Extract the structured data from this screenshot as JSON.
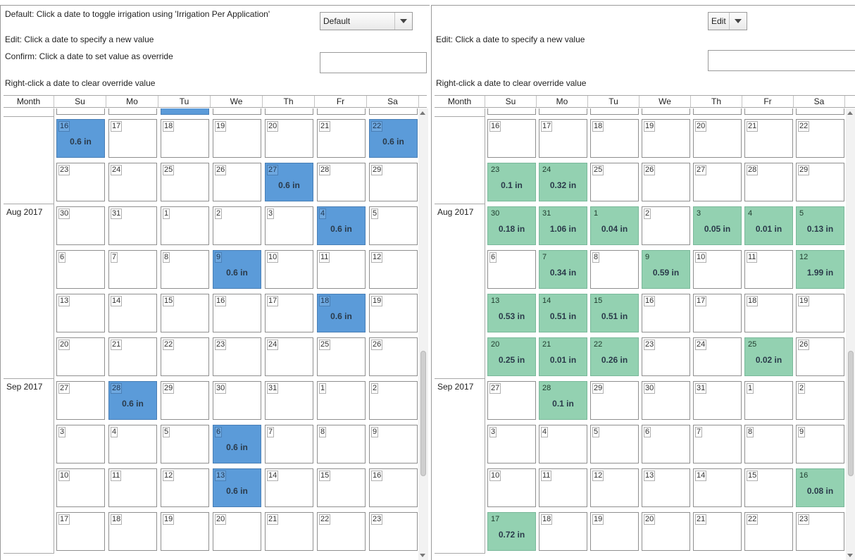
{
  "left": {
    "instructions": {
      "default": "Default: Click a date to toggle irrigation using 'Irrigation Per Application'",
      "edit": "Edit: Click a date to specify a new value",
      "confirm": "Confirm: Click a date to set value as override",
      "right_click": "Right-click a date to clear override value"
    },
    "mode_dropdown": {
      "value": "Default"
    },
    "override_input": {
      "value": ""
    },
    "headers": [
      "Month",
      "Su",
      "Mo",
      "Tu",
      "We",
      "Th",
      "Fr",
      "Sa"
    ],
    "months": [
      {
        "label": "",
        "rows": 2
      },
      {
        "label": "Aug 2017",
        "rows": 4
      },
      {
        "label": "Sep 2017",
        "rows": 4
      }
    ],
    "weeks": [
      [
        {
          "d": "16",
          "v": "0.6 in"
        },
        {
          "d": "17",
          "v": ""
        },
        {
          "d": "18",
          "v": ""
        },
        {
          "d": "19",
          "v": ""
        },
        {
          "d": "20",
          "v": ""
        },
        {
          "d": "21",
          "v": ""
        },
        {
          "d": "22",
          "v": "0.6 in"
        }
      ],
      [
        {
          "d": "23",
          "v": ""
        },
        {
          "d": "24",
          "v": ""
        },
        {
          "d": "25",
          "v": ""
        },
        {
          "d": "26",
          "v": ""
        },
        {
          "d": "27",
          "v": "0.6 in"
        },
        {
          "d": "28",
          "v": ""
        },
        {
          "d": "29",
          "v": ""
        }
      ],
      [
        {
          "d": "30",
          "v": ""
        },
        {
          "d": "31",
          "v": ""
        },
        {
          "d": "1",
          "v": ""
        },
        {
          "d": "2",
          "v": ""
        },
        {
          "d": "3",
          "v": ""
        },
        {
          "d": "4",
          "v": "0.6 in"
        },
        {
          "d": "5",
          "v": ""
        }
      ],
      [
        {
          "d": "6",
          "v": ""
        },
        {
          "d": "7",
          "v": ""
        },
        {
          "d": "8",
          "v": ""
        },
        {
          "d": "9",
          "v": "0.6 in"
        },
        {
          "d": "10",
          "v": ""
        },
        {
          "d": "11",
          "v": ""
        },
        {
          "d": "12",
          "v": ""
        }
      ],
      [
        {
          "d": "13",
          "v": ""
        },
        {
          "d": "14",
          "v": ""
        },
        {
          "d": "15",
          "v": ""
        },
        {
          "d": "16",
          "v": ""
        },
        {
          "d": "17",
          "v": ""
        },
        {
          "d": "18",
          "v": "0.6 in"
        },
        {
          "d": "19",
          "v": ""
        }
      ],
      [
        {
          "d": "20",
          "v": ""
        },
        {
          "d": "21",
          "v": ""
        },
        {
          "d": "22",
          "v": ""
        },
        {
          "d": "23",
          "v": ""
        },
        {
          "d": "24",
          "v": ""
        },
        {
          "d": "25",
          "v": ""
        },
        {
          "d": "26",
          "v": ""
        }
      ],
      [
        {
          "d": "27",
          "v": ""
        },
        {
          "d": "28",
          "v": "0.6 in"
        },
        {
          "d": "29",
          "v": ""
        },
        {
          "d": "30",
          "v": ""
        },
        {
          "d": "31",
          "v": ""
        },
        {
          "d": "1",
          "v": ""
        },
        {
          "d": "2",
          "v": ""
        }
      ],
      [
        {
          "d": "3",
          "v": ""
        },
        {
          "d": "4",
          "v": ""
        },
        {
          "d": "5",
          "v": ""
        },
        {
          "d": "6",
          "v": "0.6 in"
        },
        {
          "d": "7",
          "v": ""
        },
        {
          "d": "8",
          "v": ""
        },
        {
          "d": "9",
          "v": ""
        }
      ],
      [
        {
          "d": "10",
          "v": ""
        },
        {
          "d": "11",
          "v": ""
        },
        {
          "d": "12",
          "v": ""
        },
        {
          "d": "13",
          "v": "0.6 in"
        },
        {
          "d": "14",
          "v": ""
        },
        {
          "d": "15",
          "v": ""
        },
        {
          "d": "16",
          "v": ""
        }
      ],
      [
        {
          "d": "17",
          "v": ""
        },
        {
          "d": "18",
          "v": ""
        },
        {
          "d": "19",
          "v": ""
        },
        {
          "d": "20",
          "v": ""
        },
        {
          "d": "21",
          "v": ""
        },
        {
          "d": "22",
          "v": ""
        },
        {
          "d": "23",
          "v": ""
        }
      ]
    ],
    "partial_top_highlight_col": 2
  },
  "right": {
    "instructions": {
      "edit": "Edit: Click a date to specify a new value",
      "right_click": "Right-click a date to clear override value"
    },
    "mode_dropdown": {
      "value": "Edit"
    },
    "value_input": {
      "value": ""
    },
    "headers": [
      "Month",
      "Su",
      "Mo",
      "Tu",
      "We",
      "Th",
      "Fr",
      "Sa"
    ],
    "months": [
      {
        "label": "",
        "rows": 2
      },
      {
        "label": "Aug 2017",
        "rows": 4
      },
      {
        "label": "Sep 2017",
        "rows": 4
      }
    ],
    "weeks": [
      [
        {
          "d": "16",
          "v": ""
        },
        {
          "d": "17",
          "v": ""
        },
        {
          "d": "18",
          "v": ""
        },
        {
          "d": "19",
          "v": ""
        },
        {
          "d": "20",
          "v": ""
        },
        {
          "d": "21",
          "v": ""
        },
        {
          "d": "22",
          "v": ""
        }
      ],
      [
        {
          "d": "23",
          "v": "0.1 in"
        },
        {
          "d": "24",
          "v": "0.32 in"
        },
        {
          "d": "25",
          "v": ""
        },
        {
          "d": "26",
          "v": ""
        },
        {
          "d": "27",
          "v": ""
        },
        {
          "d": "28",
          "v": ""
        },
        {
          "d": "29",
          "v": ""
        }
      ],
      [
        {
          "d": "30",
          "v": "0.18 in"
        },
        {
          "d": "31",
          "v": "1.06 in"
        },
        {
          "d": "1",
          "v": "0.04 in"
        },
        {
          "d": "2",
          "v": ""
        },
        {
          "d": "3",
          "v": "0.05 in"
        },
        {
          "d": "4",
          "v": "0.01 in"
        },
        {
          "d": "5",
          "v": "0.13 in"
        }
      ],
      [
        {
          "d": "6",
          "v": ""
        },
        {
          "d": "7",
          "v": "0.34 in"
        },
        {
          "d": "8",
          "v": ""
        },
        {
          "d": "9",
          "v": "0.59 in"
        },
        {
          "d": "10",
          "v": ""
        },
        {
          "d": "11",
          "v": ""
        },
        {
          "d": "12",
          "v": "1.99 in"
        }
      ],
      [
        {
          "d": "13",
          "v": "0.53 in"
        },
        {
          "d": "14",
          "v": "0.51 in"
        },
        {
          "d": "15",
          "v": "0.51 in"
        },
        {
          "d": "16",
          "v": ""
        },
        {
          "d": "17",
          "v": ""
        },
        {
          "d": "18",
          "v": ""
        },
        {
          "d": "19",
          "v": ""
        }
      ],
      [
        {
          "d": "20",
          "v": "0.25 in"
        },
        {
          "d": "21",
          "v": "0.01 in"
        },
        {
          "d": "22",
          "v": "0.26 in"
        },
        {
          "d": "23",
          "v": ""
        },
        {
          "d": "24",
          "v": ""
        },
        {
          "d": "25",
          "v": "0.02 in"
        },
        {
          "d": "26",
          "v": ""
        }
      ],
      [
        {
          "d": "27",
          "v": ""
        },
        {
          "d": "28",
          "v": "0.1 in"
        },
        {
          "d": "29",
          "v": ""
        },
        {
          "d": "30",
          "v": ""
        },
        {
          "d": "31",
          "v": ""
        },
        {
          "d": "1",
          "v": ""
        },
        {
          "d": "2",
          "v": ""
        }
      ],
      [
        {
          "d": "3",
          "v": ""
        },
        {
          "d": "4",
          "v": ""
        },
        {
          "d": "5",
          "v": ""
        },
        {
          "d": "6",
          "v": ""
        },
        {
          "d": "7",
          "v": ""
        },
        {
          "d": "8",
          "v": ""
        },
        {
          "d": "9",
          "v": ""
        }
      ],
      [
        {
          "d": "10",
          "v": ""
        },
        {
          "d": "11",
          "v": ""
        },
        {
          "d": "12",
          "v": ""
        },
        {
          "d": "13",
          "v": ""
        },
        {
          "d": "14",
          "v": ""
        },
        {
          "d": "15",
          "v": ""
        },
        {
          "d": "16",
          "v": "0.08 in"
        }
      ],
      [
        {
          "d": "17",
          "v": "0.72 in"
        },
        {
          "d": "18",
          "v": ""
        },
        {
          "d": "19",
          "v": ""
        },
        {
          "d": "20",
          "v": ""
        },
        {
          "d": "21",
          "v": ""
        },
        {
          "d": "22",
          "v": ""
        },
        {
          "d": "23",
          "v": ""
        }
      ]
    ]
  },
  "colors": {
    "default_irrigation": "#5b9bd9",
    "edited_value": "#93d1b1"
  },
  "icons": {
    "dropdown": "chevron-down-icon",
    "scroll_up": "scroll-up-arrow-icon",
    "scroll_down": "scroll-down-arrow-icon"
  }
}
